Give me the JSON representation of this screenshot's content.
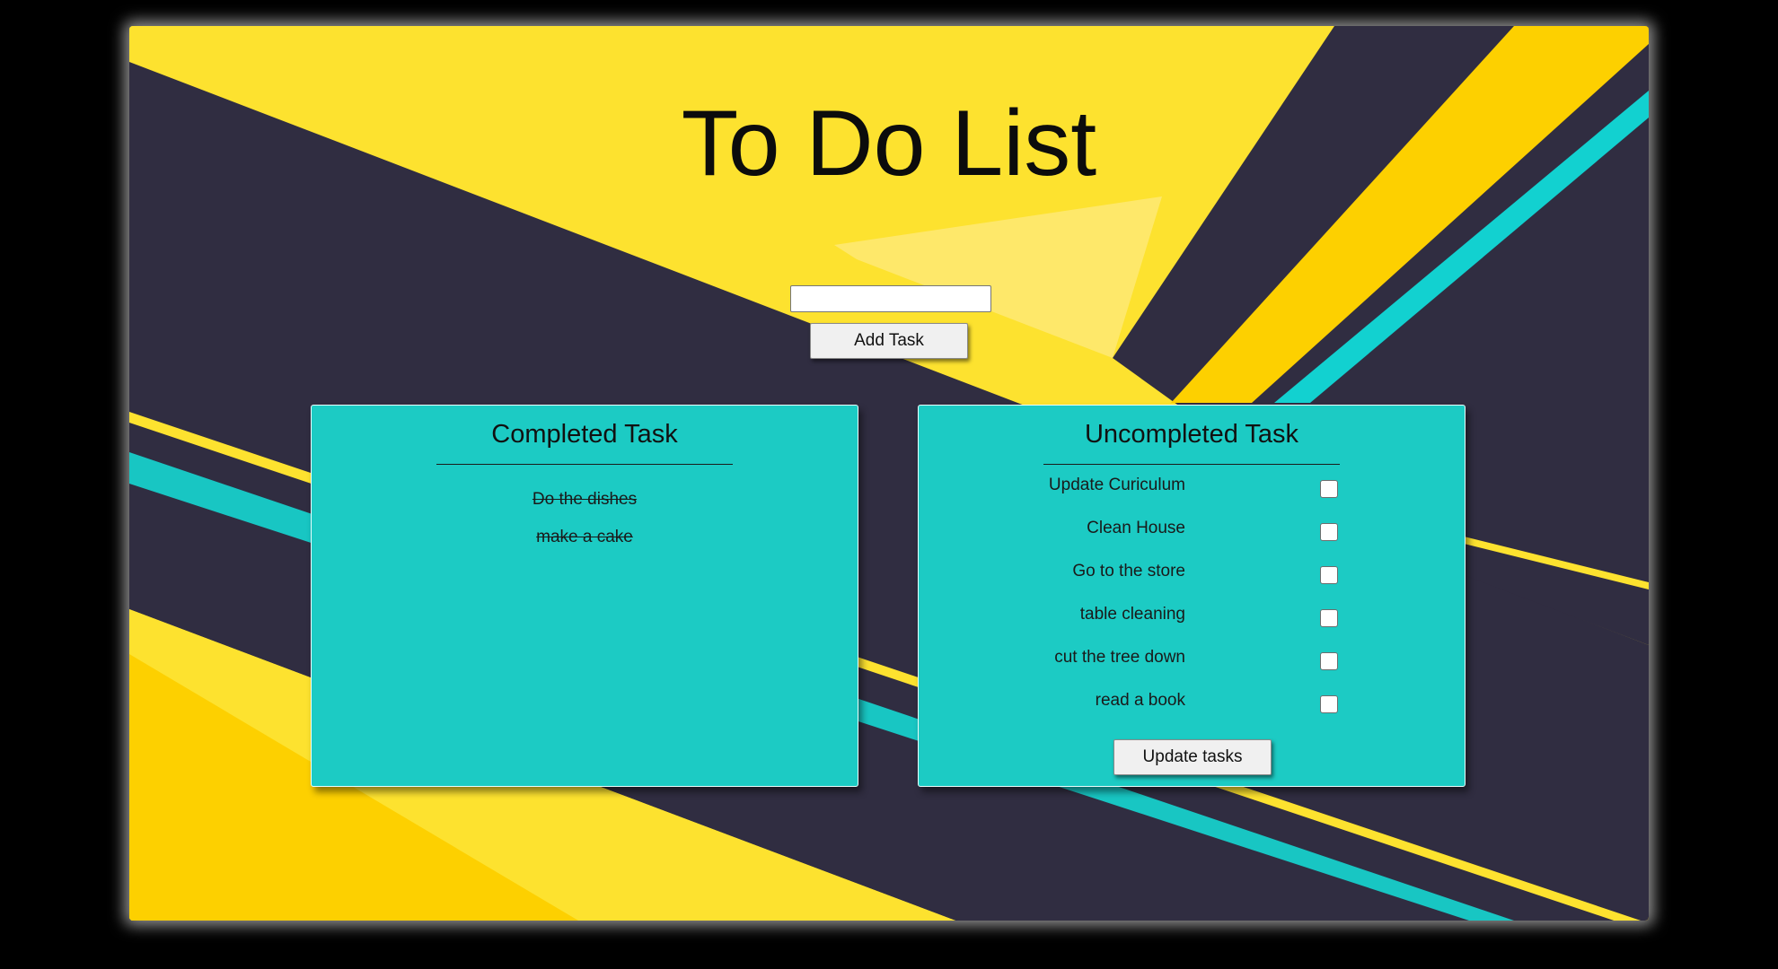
{
  "app": {
    "title": "To Do List"
  },
  "new_task": {
    "value": "",
    "placeholder": "",
    "add_label": "Add Task"
  },
  "completed": {
    "title": "Completed Task",
    "items": [
      "Do the dishes",
      "make a cake"
    ]
  },
  "uncompleted": {
    "title": "Uncompleted Task",
    "items": [
      {
        "label": "Update Curiculum",
        "checked": false
      },
      {
        "label": "Clean House",
        "checked": false
      },
      {
        "label": "Go to the store",
        "checked": false
      },
      {
        "label": "table cleaning",
        "checked": false
      },
      {
        "label": "cut the tree down",
        "checked": false
      },
      {
        "label": "read a book",
        "checked": false
      }
    ],
    "update_label": "Update tasks"
  },
  "colors": {
    "yellow": "#fde22f",
    "gold": "#fdd000",
    "navy": "#302d41",
    "teal": "#1ccbc4",
    "cyan_stripe": "#12d1d0"
  }
}
